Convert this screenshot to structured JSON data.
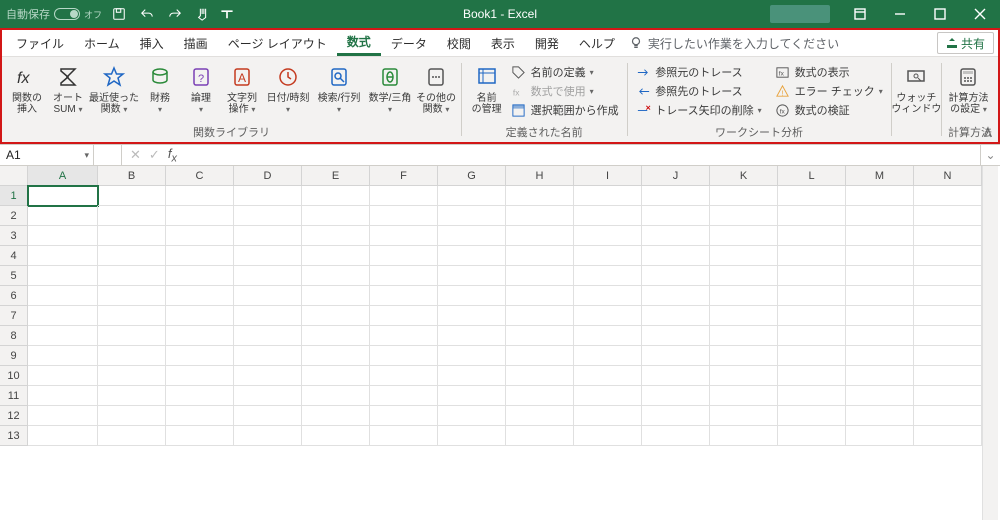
{
  "title": "Book1  -  Excel",
  "autosave_label": "自動保存",
  "autosave_state": "オフ",
  "tabs": [
    "ファイル",
    "ホーム",
    "挿入",
    "描画",
    "ページ レイアウト",
    "数式",
    "データ",
    "校閲",
    "表示",
    "開発",
    "ヘルプ"
  ],
  "active_tab": 5,
  "tellme_placeholder": "実行したい作業を入力してください",
  "share_label": "共有",
  "ribbon": {
    "insert_fn": "関数の\n挿入",
    "autosum": "オート\nSUM",
    "recent": "最近使った\n関数",
    "financial": "財務",
    "logical": "論理",
    "text": "文字列\n操作",
    "datetime": "日付/時刻",
    "lookup": "検索/行列",
    "math": "数学/三角",
    "more": "その他の\n関数",
    "lib_group": "関数ライブラリ",
    "name_mgr": "名前\nの管理",
    "define_name": "名前の定義",
    "use_in_formula": "数式で使用",
    "create_from_sel": "選択範囲から作成",
    "names_group": "定義された名前",
    "trace_prec": "参照元のトレース",
    "trace_dep": "参照先のトレース",
    "remove_arrows": "トレース矢印の削除",
    "show_formulas": "数式の表示",
    "error_check": "エラー チェック",
    "eval_formula": "数式の検証",
    "audit_group": "ワークシート分析",
    "watch": "ウォッチ\nウィンドウ",
    "calc_opts": "計算方法\nの設定",
    "calc_group": "計算方法"
  },
  "name_box_value": "A1",
  "columns": [
    "A",
    "B",
    "C",
    "D",
    "E",
    "F",
    "G",
    "H",
    "I",
    "J",
    "K",
    "L",
    "M",
    "N"
  ],
  "rows": [
    1,
    2,
    3,
    4,
    5,
    6,
    7,
    8,
    9,
    10,
    11,
    12,
    13
  ],
  "active_cell": {
    "col": "A",
    "row": 1
  }
}
